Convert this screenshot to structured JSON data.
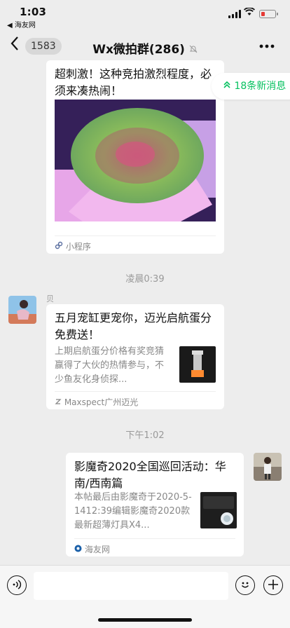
{
  "status": {
    "time": "1:03",
    "back_app": "◀ 海友网"
  },
  "nav": {
    "unread_count": "1583",
    "title": "Wx微拍群(286)"
  },
  "new_messages": {
    "label": "18条新消息"
  },
  "messages": [
    {
      "title": "超刺激！这种竞拍激烈程度，必须来凑热闹！",
      "source": "小程序"
    },
    {
      "timestamp": "凌晨0:39"
    },
    {
      "sender": "贝",
      "title": "五月宠缸更宠你，迈光启航蛋分免费送！",
      "desc": "上期启航蛋分价格有奖竞猜赢得了大伙的热情参与，不少鱼友化身侦探...",
      "source": "Maxspect广州迈光"
    },
    {
      "timestamp": "下午1:02"
    },
    {
      "title": "影魔奇2020全国巡回活动：华南/西南篇",
      "desc": "本帖最后由影魔奇于2020-5-1412:39编辑影魔奇2020款最新超薄灯具X4...",
      "source": "海友网"
    }
  ]
}
